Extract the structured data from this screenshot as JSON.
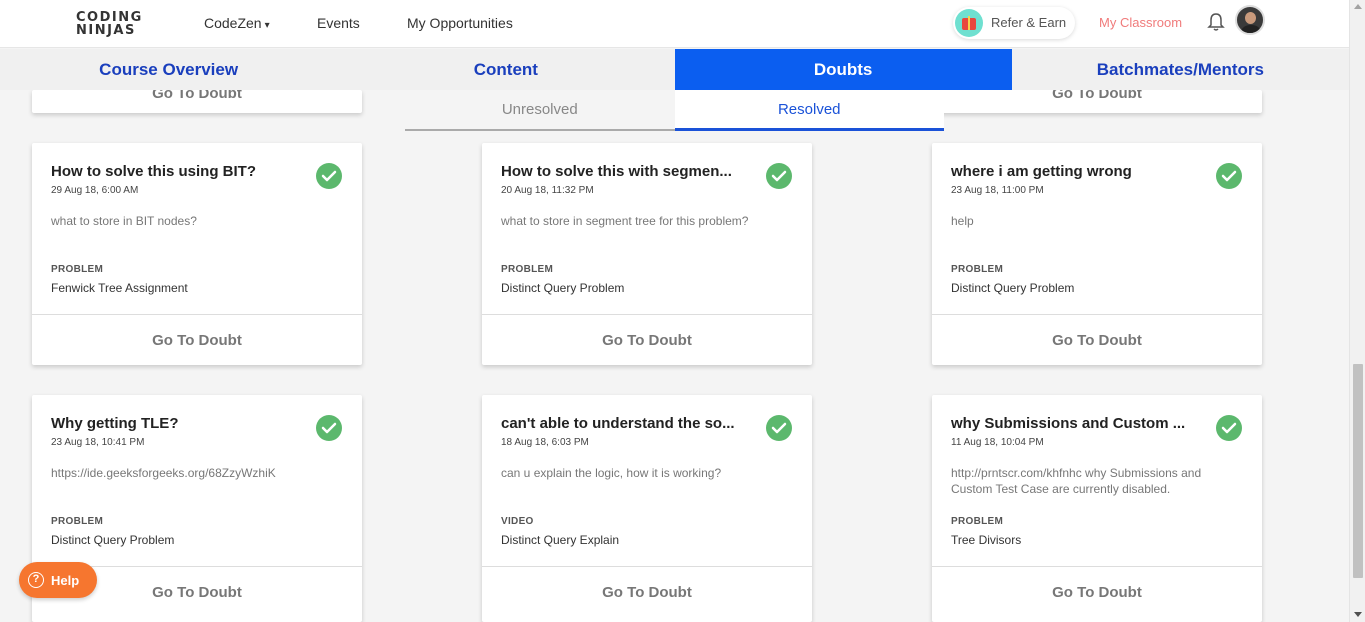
{
  "nav": {
    "logo_line1": "CODING",
    "logo_line2": "NINJAS",
    "codezen": "CodeZen",
    "events": "Events",
    "opportunities": "My Opportunities",
    "refer_earn": "Refer & Earn",
    "my_classroom": "My Classroom"
  },
  "tabs": [
    "Course Overview",
    "Content",
    "Doubts",
    "Batchmates/Mentors"
  ],
  "active_tab": "Doubts",
  "subtabs": {
    "unresolved": "Unresolved",
    "resolved": "Resolved"
  },
  "active_subtab": "Resolved",
  "partial_cards": [
    "Go To Doubt",
    "Go To Doubt"
  ],
  "cards": [
    {
      "title": "How to solve this using BIT?",
      "date": "29 Aug 18, 6:00 AM",
      "desc": "what to store in BIT nodes?",
      "type": "PROBLEM",
      "name": "Fenwick Tree Assignment",
      "button": "Go To Doubt"
    },
    {
      "title": "How to solve this with segmen...",
      "date": "20 Aug 18, 11:32 PM",
      "desc": "what to store in segment tree for this problem?",
      "type": "PROBLEM",
      "name": "Distinct Query Problem",
      "button": "Go To Doubt"
    },
    {
      "title": "where i am getting wrong",
      "date": "23 Aug 18, 11:00 PM",
      "desc": "help",
      "type": "PROBLEM",
      "name": "Distinct Query Problem",
      "button": "Go To Doubt"
    },
    {
      "title": "Why getting TLE?",
      "date": "23 Aug 18, 10:41 PM",
      "desc": "https://ide.geeksforgeeks.org/68ZzyWzhiK",
      "type": "PROBLEM",
      "name": "Distinct Query Problem",
      "button": "Go To Doubt"
    },
    {
      "title": "can't able to understand the so...",
      "date": "18 Aug 18, 6:03 PM",
      "desc": "can u explain the logic, how it is working?",
      "type": "VIDEO",
      "name": "Distinct Query Explain",
      "button": "Go To Doubt"
    },
    {
      "title": "why Submissions and Custom ...",
      "date": "11 Aug 18, 10:04 PM",
      "desc": "http://prntscr.com/khfnhc why Submissions and Custom Test Case are currently disabled.",
      "type": "PROBLEM",
      "name": "Tree Divisors",
      "button": "Go To Doubt"
    }
  ],
  "help": "Help",
  "colors": {
    "primary": "#0b5ef0",
    "tab_text": "#1a3fbd",
    "resolved_check": "#5cb86d",
    "help_orange": "#f6762f",
    "classroom": "#f07b7b"
  }
}
